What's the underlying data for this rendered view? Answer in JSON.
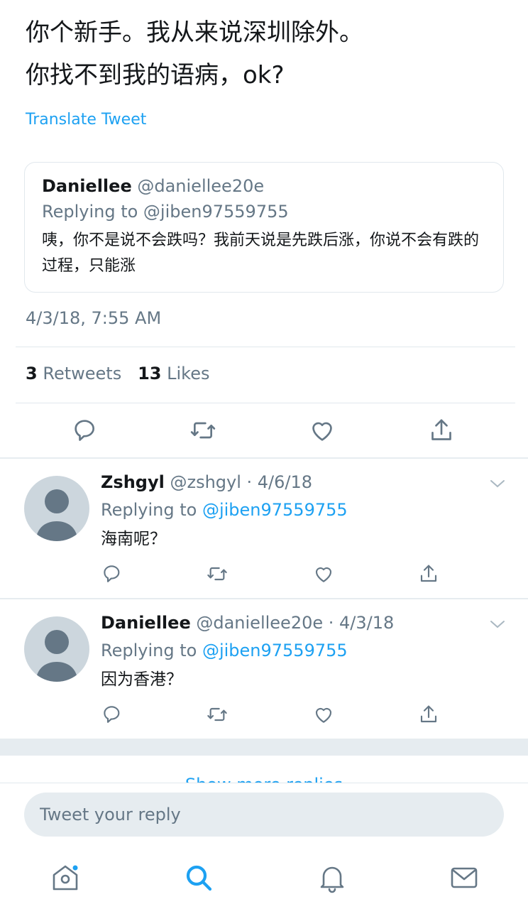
{
  "tweet": {
    "line1": "你个新手。我从来说深圳除外。",
    "line2": "你找不到我的语病，ok?",
    "translate_label": "Translate Tweet",
    "timestamp": "4/3/18, 7:55 AM",
    "retweets_count": "3",
    "retweets_label": "Retweets",
    "likes_count": "13",
    "likes_label": "Likes"
  },
  "quoted_tweet": {
    "name": "Daniellee",
    "handle": "@daniellee20e",
    "replying_to": "Replying to @jiben97559755",
    "text": "咦，你不是说不会跌吗？我前天说是先跌后涨，你说不会有跌的过程，只能涨"
  },
  "replies": [
    {
      "name": "Zshgyl",
      "meta": "@zshgyl · 4/6/18",
      "replying_prefix": "Replying to ",
      "mention": "@jiben97559755",
      "text": "海南呢？"
    },
    {
      "name": "Daniellee",
      "meta": "@daniellee20e · 4/3/18",
      "replying_prefix": "Replying to ",
      "mention": "@jiben97559755",
      "text": "因为香港？"
    }
  ],
  "show_more_label": "Show more replies",
  "composer": {
    "placeholder": "Tweet your reply"
  },
  "icons": {
    "reply": "reply-icon",
    "retweet": "retweet-icon",
    "like": "heart-icon",
    "share": "share-icon",
    "home": "home-icon",
    "search": "search-icon",
    "notifications": "bell-icon",
    "messages": "mail-icon"
  },
  "colors": {
    "accent": "#1da1f2",
    "text_primary": "#14171a",
    "text_secondary": "#657786",
    "divider": "#e1e8ed",
    "separator_band": "#e6ecf0"
  }
}
